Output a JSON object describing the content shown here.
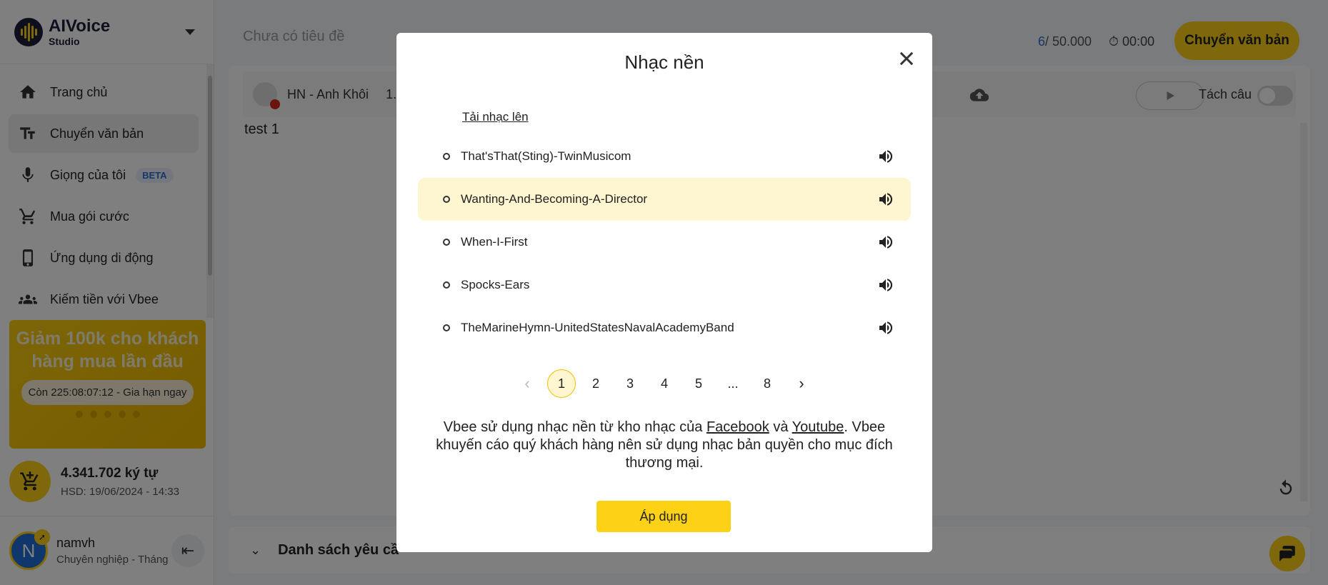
{
  "brand": {
    "name_line1": "AIVoice",
    "name_line2": "Studio"
  },
  "sidebar": {
    "items": [
      {
        "label": "Trang chủ",
        "icon": "home-icon"
      },
      {
        "label": "Chuyển văn bản",
        "icon": "text-icon",
        "active": true
      },
      {
        "label": "Giọng của tôi",
        "icon": "microphone-icon",
        "badge": "BETA"
      },
      {
        "label": "Mua gói cước",
        "icon": "cart-icon"
      },
      {
        "label": "Ứng dụng di động",
        "icon": "phone-icon"
      },
      {
        "label": "Kiếm tiền với Vbee",
        "icon": "people-icon"
      }
    ],
    "promo": {
      "title": "Giảm 100k cho khách hàng mua lần đầu",
      "cta": "Còn 225:08:07:12 - Gia hạn ngay"
    },
    "credit": {
      "amount": "4.341.702 ký tự",
      "expiry": "HSD: 19/06/2024 - 14:33"
    },
    "user": {
      "initial": "N",
      "name": "namvh",
      "plan": "Chuyên nghiệp - Tháng"
    }
  },
  "main": {
    "doc_title": "Chưa có tiêu đề",
    "counter_current": "6",
    "counter_max": "/ 50.000",
    "timer": "00:00",
    "convert_label": "Chuyển văn bản",
    "voice_name": "HN - Anh Khôi",
    "voice_speed": "1.",
    "split_label": "Tách câu",
    "editor_text": "test 1",
    "requests_title": "Danh sách yêu cầ"
  },
  "modal": {
    "title": "Nhạc nền",
    "upload_label": "Tải nhạc lên",
    "tracks": [
      {
        "name": "That'sThat(Sting)-TwinMusicom",
        "selected": false
      },
      {
        "name": "Wanting-And-Becoming-A-Director",
        "selected": true
      },
      {
        "name": "When-I-First",
        "selected": false
      },
      {
        "name": "Spocks-Ears",
        "selected": false
      },
      {
        "name": "TheMarineHymn-UnitedStatesNavalAcademyBand",
        "selected": false
      }
    ],
    "pagination": {
      "pages": [
        "1",
        "2",
        "3",
        "4",
        "5",
        "...",
        "8"
      ],
      "current": "1",
      "prev": "‹",
      "next": "›"
    },
    "notice_part1": "Vbee sử dụng nhạc nền từ kho nhạc của ",
    "notice_link1": "Facebook",
    "notice_part2": " và ",
    "notice_link2": "Youtube",
    "notice_part3": ". Vbee khuyến cáo quý khách hàng nên sử dụng nhạc bản quyền cho mục đích thương mại.",
    "apply_label": "Áp dụng"
  },
  "colors": {
    "accent": "#fcd116",
    "selected_row": "#fef6d0",
    "link_blue": "#2f6fd1",
    "overlay": "rgba(0,0,0,0.5)"
  }
}
